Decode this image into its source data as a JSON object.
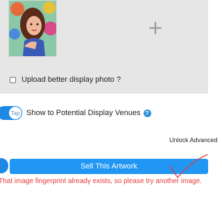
{
  "upload": {
    "add_glyph": "+",
    "better_photo_label": "Upload better display photo ?",
    "better_photo_checked": false
  },
  "venues": {
    "toggle_label": "Tap",
    "label": "Show to Potential Display Venues",
    "help_glyph": "?"
  },
  "advanced": {
    "unlock_label": "Unlock Advanced"
  },
  "actions": {
    "sell_label": "Sell This Artwork"
  },
  "error": {
    "message": "That image fingerprint already exists, so please try another image."
  },
  "colors": {
    "accent": "#2196f3",
    "error": "#e53935",
    "annotation": "#e53935"
  },
  "icons": [
    "plus-icon",
    "help-icon",
    "check-icon"
  ]
}
